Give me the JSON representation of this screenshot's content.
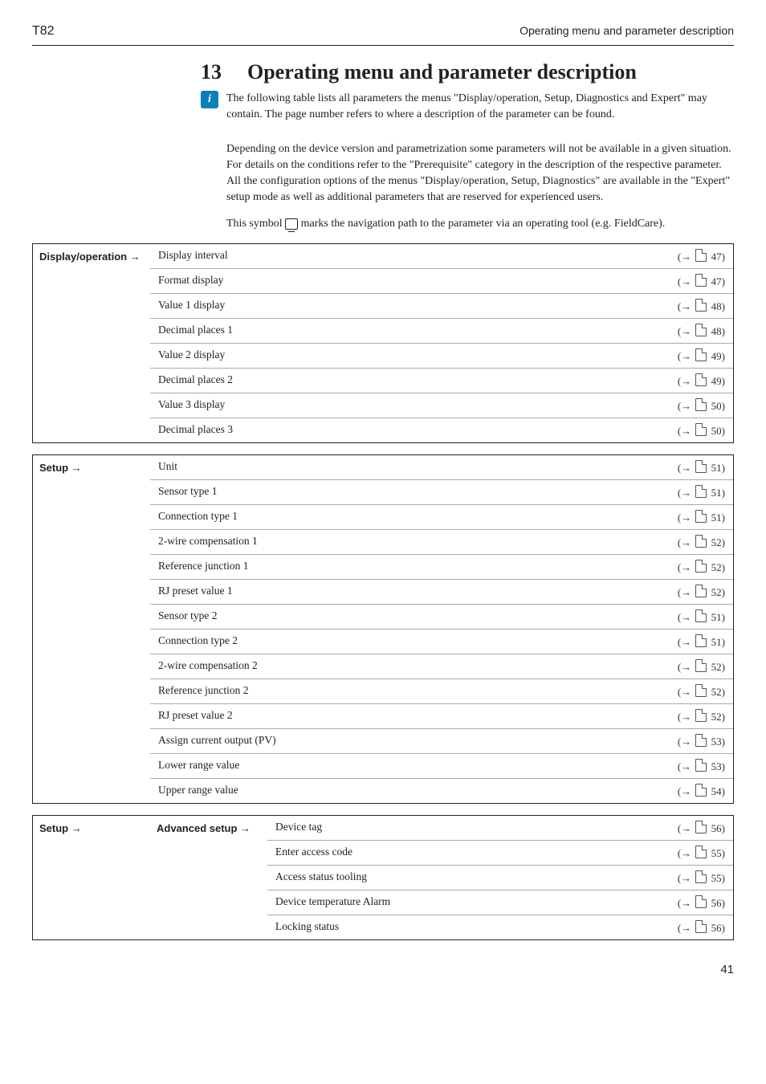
{
  "hdr": {
    "left": "T82",
    "right": "Operating menu and parameter description"
  },
  "chapter": {
    "num": "13",
    "title": "Operating menu and parameter description"
  },
  "intro": {
    "p1": "The following table lists all parameters the menus \"Display/operation, Setup, Diagnostics and Expert\" may contain. The page number refers to where a description of the parameter can be found.",
    "p2": "Depending on the device version and parametrization some parameters will not be available in a given situation. For details on the conditions refer to the \"Prerequisite\" category in the description of the respective parameter. All the configuration options of the menus \"Display/operation, Setup, Diagnostics\" are available in the \"Expert\" setup mode as well as additional parameters that are reserved for experienced users.",
    "p3a": "This symbol ",
    "p3b": " marks the navigation path to the parameter via an operating tool (e.g. FieldCare)."
  },
  "tables": [
    {
      "cat": "Display/operation →",
      "rows": [
        {
          "name": "Display interval",
          "page": "47"
        },
        {
          "name": "Format display",
          "page": "47"
        },
        {
          "name": "Value 1 display",
          "page": "48"
        },
        {
          "name": "Decimal places 1",
          "page": "48"
        },
        {
          "name": "Value 2 display",
          "page": "49"
        },
        {
          "name": "Decimal places 2",
          "page": "49"
        },
        {
          "name": "Value 3 display",
          "page": "50"
        },
        {
          "name": "Decimal places 3",
          "page": "50"
        }
      ]
    },
    {
      "cat": "Setup →",
      "rows": [
        {
          "name": "Unit",
          "page": "51"
        },
        {
          "name": "Sensor type 1",
          "page": "51"
        },
        {
          "name": "Connection type 1",
          "page": "51"
        },
        {
          "name": "2-wire compensation 1",
          "page": "52"
        },
        {
          "name": "Reference junction 1",
          "page": "52"
        },
        {
          "name": "RJ preset value 1",
          "page": "52"
        },
        {
          "name": "Sensor type 2",
          "page": "51"
        },
        {
          "name": "Connection type 2",
          "page": "51"
        },
        {
          "name": "2-wire compensation 2",
          "page": "52"
        },
        {
          "name": "Reference junction 2",
          "page": "52"
        },
        {
          "name": "RJ preset value 2",
          "page": "52"
        },
        {
          "name": "Assign current output (PV)",
          "page": "53"
        },
        {
          "name": "Lower range value",
          "page": "53"
        },
        {
          "name": "Upper range value",
          "page": "54"
        }
      ]
    },
    {
      "cat": "Setup →",
      "sub": "Advanced setup →",
      "rows": [
        {
          "name": "Device tag",
          "page": "56"
        },
        {
          "name": "Enter access code",
          "page": "55"
        },
        {
          "name": "Access status tooling",
          "page": "55"
        },
        {
          "name": "Device temperature Alarm",
          "page": "56"
        },
        {
          "name": "Locking status",
          "page": "56"
        }
      ]
    }
  ],
  "footer": {
    "page": "41"
  }
}
